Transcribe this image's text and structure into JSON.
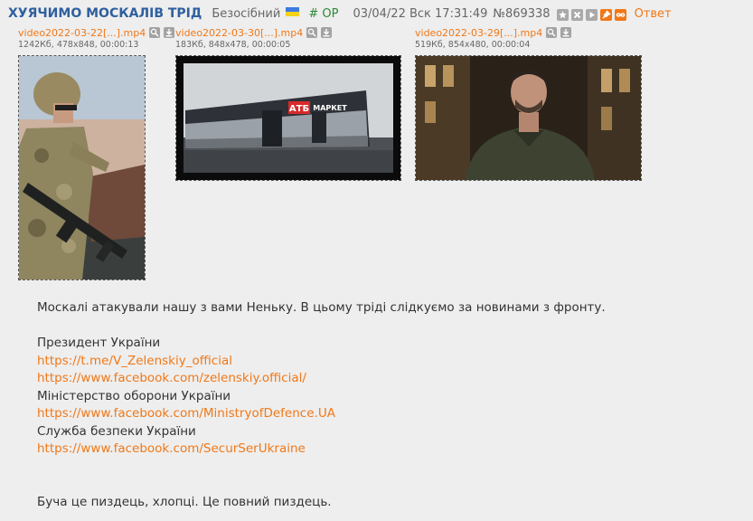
{
  "post": {
    "title": "ХУЯЧИМО МОСКАЛІВ ТРІД",
    "author": "Безосібний",
    "op_tag": "# OP",
    "datetime": "03/04/22 Вск 17:31:49",
    "number": "№869338",
    "reply_label": "Ответ",
    "action_icons": [
      "star-icon",
      "hide-icon",
      "play-icon",
      "pin-icon",
      "infinity-icon"
    ]
  },
  "files": [
    {
      "name": "video2022-03-22[...].mp4",
      "meta": "1242Кб, 478x848, 00:00:13",
      "thumb": "soldier-with-rifle"
    },
    {
      "name": "video2022-03-30[...].mp4",
      "meta": "183Кб, 848x478, 00:00:05",
      "thumb": "atb-market-building",
      "sign_logo": "АТБ",
      "sign_text": "МАРКЕТ"
    },
    {
      "name": "video2022-03-29[...].mp4",
      "meta": "519Кб, 854x480, 00:00:04",
      "thumb": "man-speaking-at-night"
    }
  ],
  "body": {
    "intro": "Москалі атакували нашу з вами Неньку. В цьому тріді слідкуємо за новинами з фронту.",
    "sections": [
      {
        "label": "Президент України",
        "links": [
          "https://t.me/V_Zelenskiy_official",
          "https://www.facebook.com/zelenskiy.official/"
        ]
      },
      {
        "label": "Міністерство оборони України",
        "links": [
          "https://www.facebook.com/MinistryofDefence.UA"
        ]
      },
      {
        "label": "Служба безпеки України",
        "links": [
          "https://www.facebook.com/SecurSerUkraine"
        ]
      }
    ],
    "closing": "Буча це пиздець, хлопці. Це повний пиздець."
  },
  "colors": {
    "background": "#eeeeee",
    "title": "#2f5f9f",
    "link": "#f07818",
    "op": "#2a8a36",
    "text": "#333333"
  }
}
